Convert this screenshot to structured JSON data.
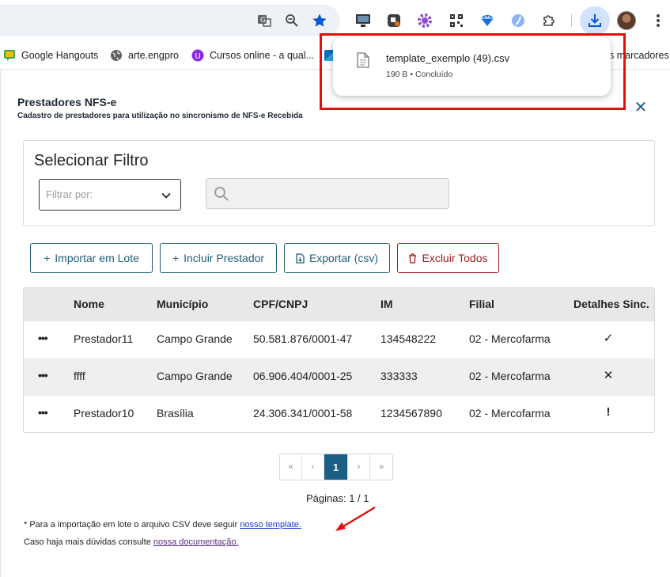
{
  "browser": {
    "bookmarks": [
      {
        "label": "Google Hangouts",
        "icon": "hangouts-icon"
      },
      {
        "label": "arte.engpro",
        "icon": "globe-icon"
      },
      {
        "label": "Cursos online - a qual...",
        "icon": "cursos-icon"
      }
    ],
    "bookmarks_overflow": "s marcadores",
    "download": {
      "filename": "template_exemplo (49).csv",
      "status": "190 B • Concluído"
    },
    "accent_color": "#0b57d0"
  },
  "page": {
    "title": "Prestadores NFS-e",
    "subtitle": "Cadastro de prestadores para utilização no sincronismo de NFS-e Recebida",
    "close_label": "✕"
  },
  "filter": {
    "title": "Selecionar Filtro",
    "select_placeholder": "Filtrar por:",
    "search_value": ""
  },
  "actions": {
    "import": "Importar em Lote",
    "add": "Incluir Prestador",
    "export": "Exportar (csv)",
    "delete_all": "Excluir Todos"
  },
  "table": {
    "columns": [
      "Nome",
      "Município",
      "CPF/CNPJ",
      "IM",
      "Filial",
      "Detalhes Sinc."
    ],
    "rows": [
      {
        "menu": "•••",
        "nome": "Prestador11",
        "municipio": "Campo Grande",
        "cnpj": "50.581.876/0001-47",
        "im": "134548222",
        "filial": "02 - Mercofarma",
        "status": "✓"
      },
      {
        "menu": "•••",
        "nome": "ffff",
        "municipio": "Campo Grande",
        "cnpj": "06.906.404/0001-25",
        "im": "333333",
        "filial": "02 - Mercofarma",
        "status": "✕"
      },
      {
        "menu": "•••",
        "nome": "Prestador10",
        "municipio": "Brasília",
        "cnpj": "24.306.341/0001-58",
        "im": "1234567890",
        "filial": "02 - Mercofarma",
        "status": "!"
      }
    ]
  },
  "pagination": {
    "first": "«",
    "prev": "‹",
    "current": "1",
    "next": "›",
    "last": "»",
    "info": "Páginas: 1 / 1"
  },
  "notes": {
    "line1_text": "* Para a importação em lote o arquivo CSV deve seguir ",
    "line1_link": "nosso template.",
    "line2_text": "Caso haja mais dúvidas consulte ",
    "line2_link": "nossa documentação."
  },
  "colors": {
    "primary": "#1f5f7a",
    "danger": "#9b1c1c",
    "pager_active": "#1b5f85",
    "annotation": "#e01010"
  }
}
